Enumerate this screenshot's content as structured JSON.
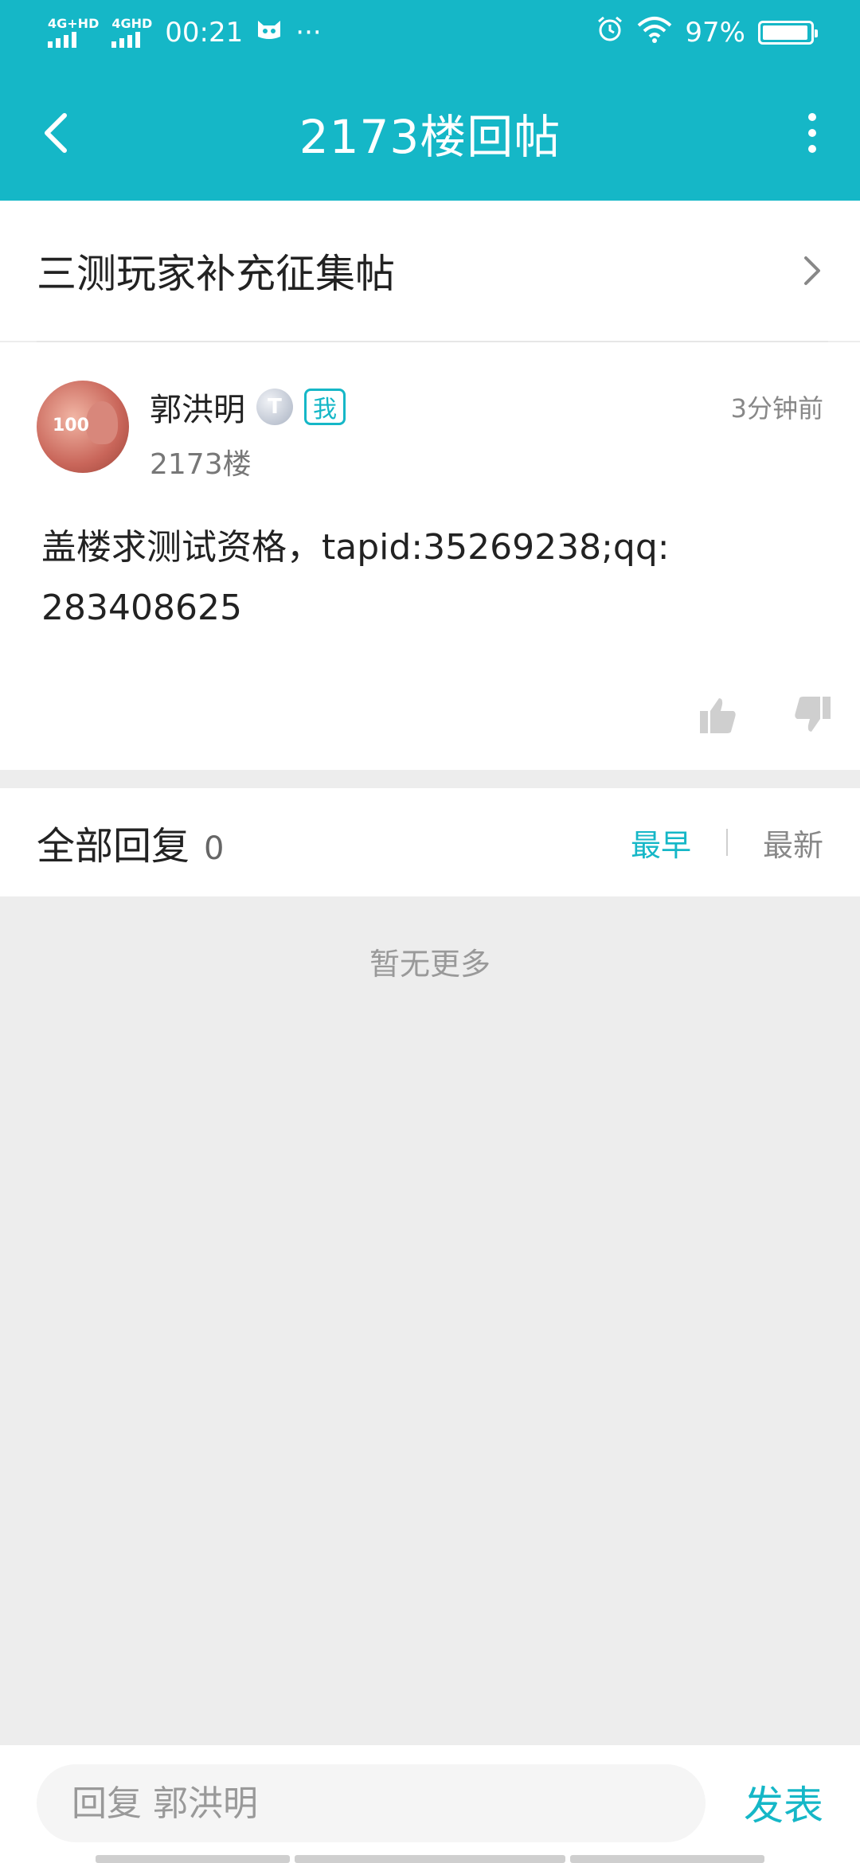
{
  "status_bar": {
    "network1": "4G+HD",
    "network2": "4GHD",
    "time": "00:21",
    "dots": "···",
    "battery": "97%",
    "battery_level": 0.97
  },
  "app_bar": {
    "title": "2173楼回帖"
  },
  "topic": {
    "title": "三测玩家补充征集帖"
  },
  "post": {
    "username": "郭洪明",
    "level_badge": "T",
    "me_badge": "我",
    "floor": "2173楼",
    "time": "3分钟前",
    "content_line1": "盖楼求测试资格，tapid:35269238;qq:",
    "content_line2": "283408625",
    "avatar_label": "100"
  },
  "replies": {
    "title": "全部回复",
    "count": "0",
    "sort_earliest": "最早",
    "sort_newest": "最新",
    "empty_text": "暂无更多"
  },
  "composer": {
    "placeholder": "回复 郭洪明",
    "send_label": "发表"
  },
  "colors": {
    "accent": "#15b7c7",
    "background": "#ededed"
  }
}
